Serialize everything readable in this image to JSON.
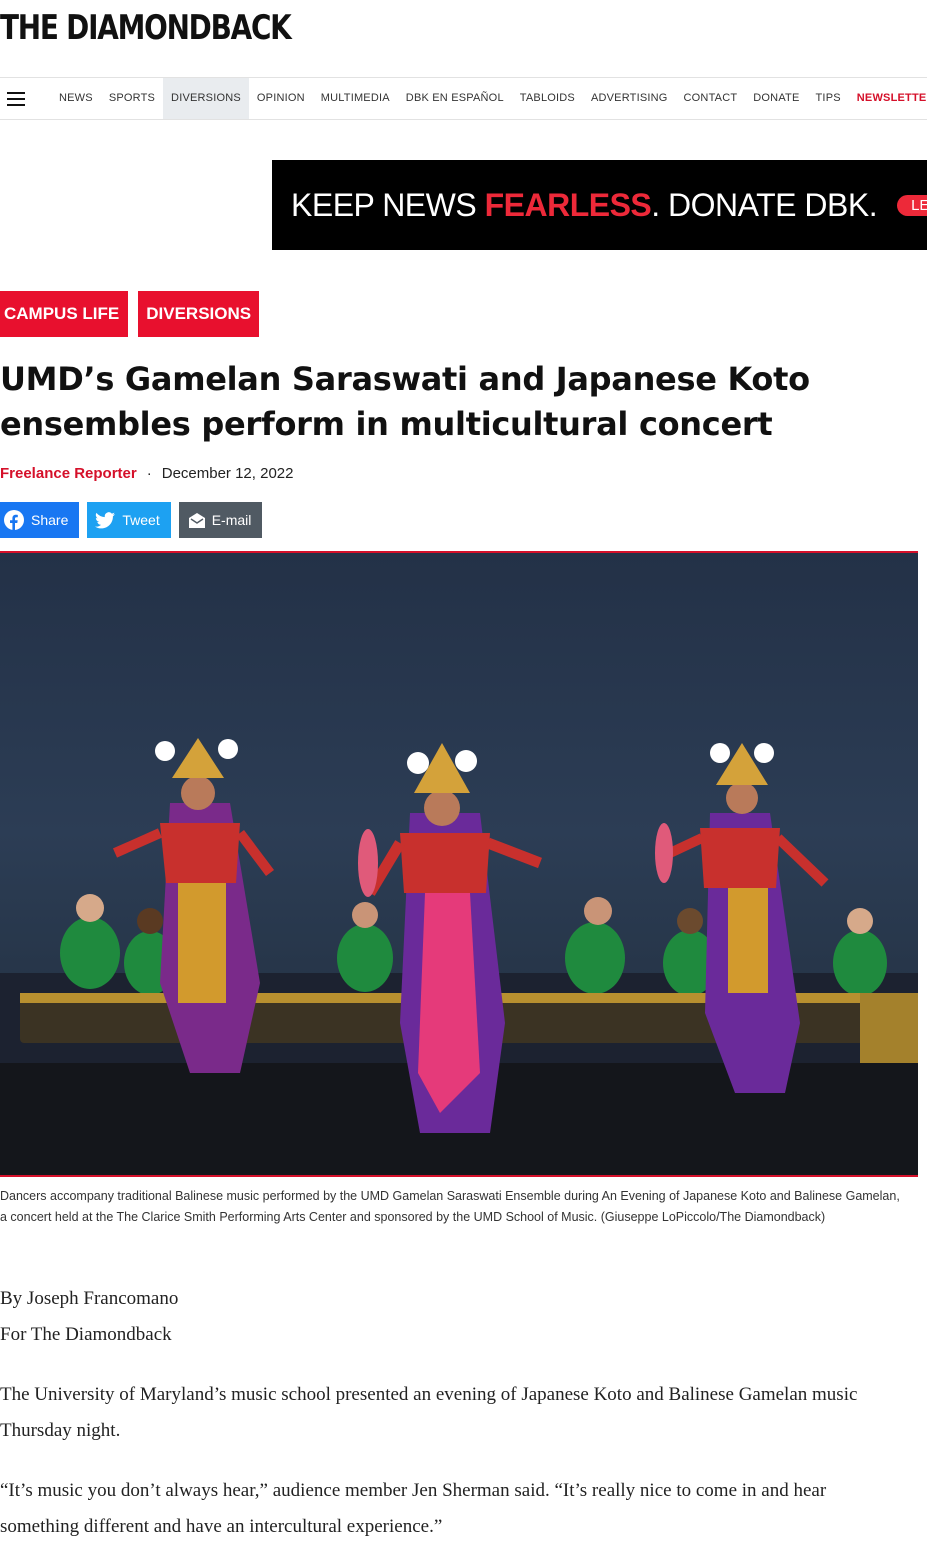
{
  "site": {
    "name": "THE DIAMONDBACK"
  },
  "nav": {
    "items": [
      {
        "label": "NEWS"
      },
      {
        "label": "SPORTS"
      },
      {
        "label": "DIVERSIONS"
      },
      {
        "label": "OPINION"
      },
      {
        "label": "MULTIMEDIA"
      },
      {
        "label": "DBK EN ESPAÑOL"
      },
      {
        "label": "TABLOIDS"
      },
      {
        "label": "ADVERTISING"
      },
      {
        "label": "CONTACT"
      },
      {
        "label": "DONATE"
      },
      {
        "label": "TIPS"
      },
      {
        "label": "NEWSLETTER"
      }
    ],
    "active": "DIVERSIONS"
  },
  "ad": {
    "text_before": "KEEP NEWS ",
    "text_highlight": "FEARLESS",
    "text_after": ". DONATE DBK.",
    "button": "LEARN MORE"
  },
  "article": {
    "tags": [
      "CAMPUS LIFE",
      "DIVERSIONS"
    ],
    "headline": "UMD’s Gamelan Saraswati and Japanese Koto ensembles perform in multicultural concert",
    "author": "Freelance Reporter",
    "separator": "·",
    "date": "December 12, 2022",
    "share": {
      "facebook": "Share",
      "twitter": "Tweet",
      "email": "E-mail"
    },
    "caption": "Dancers accompany traditional Balinese music performed by the UMD Gamelan Saraswati Ensemble during An Evening of Japanese Koto and Balinese Gamelan, a concert held at the The Clarice Smith Performing Arts Center and sponsored by the UMD School of Music. (Giuseppe LoPiccolo/The Diamondback)",
    "byline_line1": "By Joseph Francomano",
    "byline_line2": "For The Diamondback",
    "paragraphs": [
      "The University of Maryland’s music school presented an evening of Japanese Koto and Balinese Gamelan music Thursday night.",
      "“It’s music you don’t always hear,” audience member Jen Sherman said. “It’s really nice to come in and hear something different and have an intercultural experience.”"
    ]
  },
  "colors": {
    "accent": "#e8102e",
    "facebook": "#1877f2",
    "twitter": "#1da1f2",
    "email": "#505a63"
  }
}
